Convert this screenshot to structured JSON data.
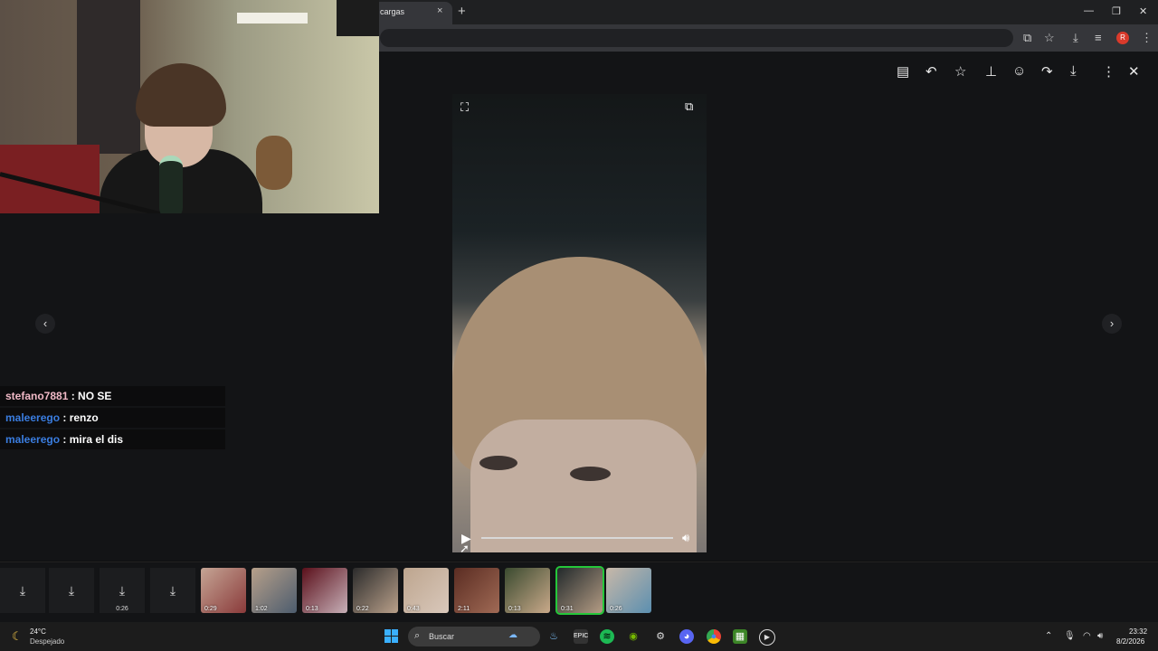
{
  "browser": {
    "tab_title": "cargas",
    "tab_close": "×",
    "new_tab": "+",
    "window_controls": [
      "—",
      "❐",
      "✕"
    ],
    "profile_initial": "R"
  },
  "viewer": {
    "toolbar_icons": [
      "caption-icon",
      "reply-icon",
      "star-icon",
      "pin-icon",
      "emoji-icon",
      "forward-icon",
      "download-icon",
      "more-icon",
      "close-icon"
    ]
  },
  "chat": [
    {
      "user": "stefano7881",
      "message": ": NO SE"
    },
    {
      "user": "maleerego",
      "message": ": renzo"
    },
    {
      "user": "maleerego",
      "message": ": mira el dis"
    }
  ],
  "media_strip": {
    "items": [
      {
        "kind": "download",
        "duration": ""
      },
      {
        "kind": "download",
        "duration": ""
      },
      {
        "kind": "download",
        "duration": "0:26"
      },
      {
        "kind": "download",
        "duration": ""
      },
      {
        "kind": "thumb",
        "duration": "0:29"
      },
      {
        "kind": "thumb",
        "duration": "1:02"
      },
      {
        "kind": "thumb",
        "duration": "0:13"
      },
      {
        "kind": "thumb",
        "duration": "0:22"
      },
      {
        "kind": "thumb",
        "duration": "0:43"
      },
      {
        "kind": "thumb",
        "duration": "2:11"
      },
      {
        "kind": "thumb",
        "duration": "0:13"
      },
      {
        "kind": "thumb",
        "duration": "0:31"
      },
      {
        "kind": "thumb",
        "duration": "0:26"
      }
    ]
  },
  "taskbar": {
    "temperature": "24°C",
    "condition": "Despejado",
    "search_placeholder": "Buscar",
    "time": "23:32",
    "date": "8/2/2026"
  }
}
